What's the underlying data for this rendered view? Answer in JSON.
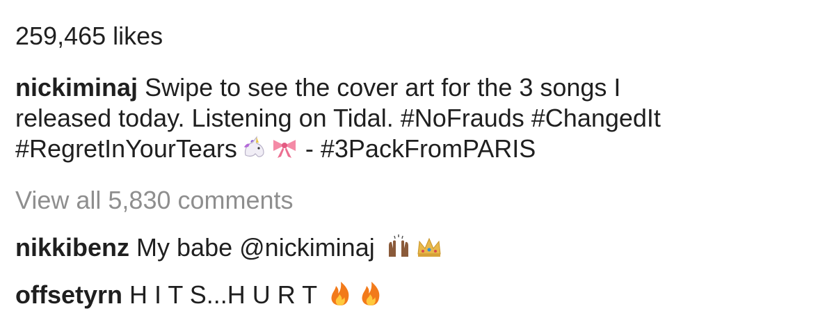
{
  "post": {
    "likes": "259,465 likes",
    "caption": {
      "username": "nickiminaj",
      "line1_text": " Swipe to see the cover art for the 3 songs I",
      "line2_text": "released today. Listening on Tidal. #NoFrauds #ChangedIt",
      "line3_tag": "#RegretInYourTears",
      "line3_rest": "- #3PackFromPARIS",
      "emojis": [
        "unicorn-icon",
        "ribbon-icon"
      ]
    },
    "view_all_comments": "View all 5,830 comments",
    "comments": [
      {
        "username": "nikkibenz",
        "text": " My babe @nickiminaj",
        "emojis": [
          "raised-hands-icon",
          "crown-icon"
        ]
      },
      {
        "username": "offsetyrn",
        "text": " H I T S...H U R T",
        "emojis": [
          "fire-icon",
          "fire-icon"
        ]
      }
    ]
  },
  "colors": {
    "text": "#1f1f1f",
    "muted": "#8e8e8e",
    "background": "#ffffff"
  }
}
